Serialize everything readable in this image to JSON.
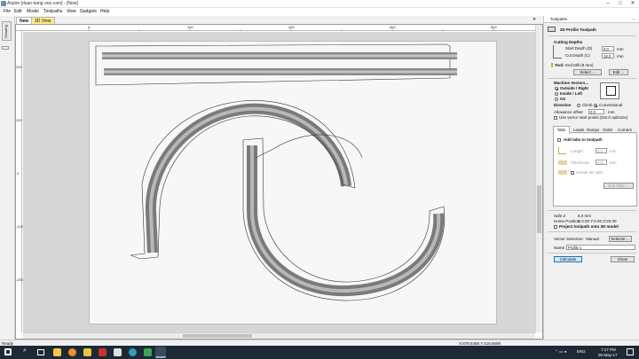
{
  "window": {
    "title": "Aspire [duan-kang ooo.cam] - [New]",
    "min": "–",
    "max": "□",
    "close": "✕"
  },
  "menu": [
    "File",
    "Edit",
    "Model",
    "Toolpaths",
    "View",
    "Gadgets",
    "Help"
  ],
  "left_panel_label": "Drawing",
  "view_tabs": [
    {
      "label": "New"
    },
    {
      "label": "3D View"
    }
  ],
  "ruler": {
    "h_labels": [
      "0",
      "200",
      "400",
      "600",
      "800"
    ],
    "v_labels": [
      "200",
      "100",
      "0",
      "-100",
      "-200"
    ]
  },
  "panel": {
    "title": "Toolpaths",
    "section_title": "2D Profile Toolpath",
    "cutting_depths": {
      "heading": "Cutting Depths",
      "start_label": "Start Depth (D)",
      "start_value": "0.0",
      "cut_label": "Cut Depth (C)",
      "cut_value": "18.0",
      "unit": "mm"
    },
    "tool": {
      "label": "Tool:",
      "name": "End Mill (8 mm)",
      "select": "Select ...",
      "edit": "Edit ..."
    },
    "machine_vectors": {
      "heading": "Machine Vectors...",
      "options": [
        "Outside / Right",
        "Inside / Left",
        "On"
      ],
      "selected": 0,
      "direction_label": "Direction",
      "direction_options": [
        "Climb",
        "Conventional"
      ],
      "direction_selected": 1,
      "allowance_label": "Allowance offset",
      "allowance_value": "0.0",
      "allowance_unit": "mm",
      "vector_start_label": "Use vector start points (Don't optimize)"
    },
    "subtabs": [
      "Tabs",
      "Leads",
      "Ramps",
      "Order",
      "Corners"
    ],
    "tabs_section": {
      "add_label": "Add tabs to toolpath",
      "length_label": "Length:",
      "length_value": "5.0",
      "thickness_label": "Thickness:",
      "thickness_value": "2.0",
      "unit": "mm",
      "create_label": "Create 3D tabs",
      "edit_button": "Edit Tabs ..."
    },
    "safe_z_label": "Safe Z",
    "safe_z_value": "6.0 mm",
    "home_label": "Home Position",
    "home_value": "X:0.00 Y:0.00 Z:20.00",
    "project_label": "Project toolpath onto 3D model",
    "vector_selection_label": "Vector Selection:",
    "vector_selection_value": "Manual",
    "selector_button": "Selector ...",
    "name_label": "Name:",
    "name_value": "Profile 1",
    "calculate": "Calculate",
    "close": "Close"
  },
  "status": {
    "left": "Ready",
    "coords": "X:878.5458 Y:418.6698"
  },
  "taskbar": {
    "lang": "ENG",
    "time": "7:17 PM",
    "date": "05-May-17"
  },
  "colors": {
    "accent": "#0078d7",
    "taskbar": "#1d2a35",
    "toolpath": "#7a7a7a"
  }
}
